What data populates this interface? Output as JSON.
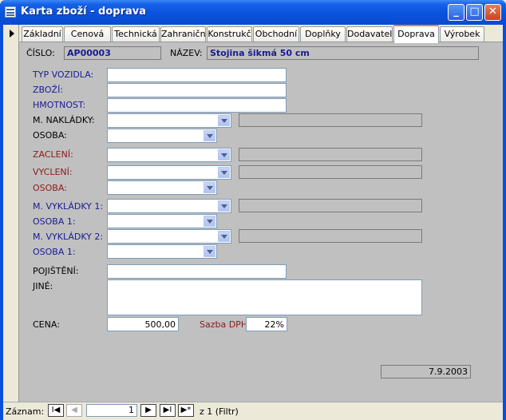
{
  "window": {
    "title": "Karta zboží - doprava"
  },
  "controls": {
    "minimize": "_",
    "maximize": "□",
    "close": "✕"
  },
  "tabs": [
    "Základní",
    "Cenová",
    "Technická",
    "Zahraničn",
    "Konstrukč",
    "Obchodní",
    "Doplňky",
    "Dodavatel",
    "Doprava",
    "Výrobek"
  ],
  "active_tab": "Doprava",
  "header": {
    "cislo_label": "ČÍSLO:",
    "cislo_value": "AP00003",
    "nazev_label": "NÁZEV:",
    "nazev_value": "Stojina šikmá 50 cm"
  },
  "form": {
    "typ_vozidla": "TYP VOZIDLA:",
    "zbozi": "ZBOŽÍ:",
    "hmotnost": "HMOTNOST:",
    "m_nakladky": "M. NAKLÁDKY:",
    "osoba1": "OSOBA:",
    "zacleni": "ZACLENÍ:",
    "vycleni": "VYCLENÍ:",
    "osoba2": "OSOBA:",
    "m_vykladky1": "M. VYKLÁDKY 1:",
    "osoba_v1": "OSOBA 1:",
    "m_vykladky2": "M. VYKLÁDKY 2:",
    "osoba_v2": "OSOBA 1:",
    "pojisteni": "POJIŠTĚNÍ:",
    "jine": "JINÉ:",
    "cena_label": "CENA:",
    "cena_value": "500,00",
    "dph_label": "Sazba DPH",
    "dph_value": "22%",
    "date_value": "7.9.2003"
  },
  "nav": {
    "label": "Záznam:",
    "first": "I◀",
    "prev": "◀",
    "current": "1",
    "next": "▶",
    "last": "▶I",
    "new": "▶*",
    "of_text": "z 1 (Filtr)"
  }
}
